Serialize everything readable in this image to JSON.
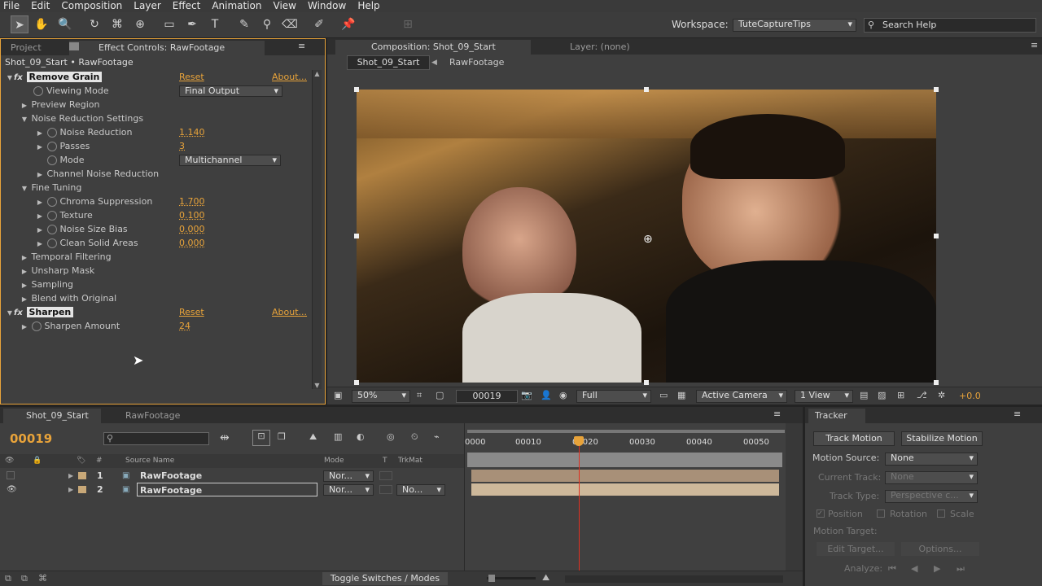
{
  "menu": [
    "File",
    "Edit",
    "Composition",
    "Layer",
    "Effect",
    "Animation",
    "View",
    "Window",
    "Help"
  ],
  "workspace": {
    "label": "Workspace:",
    "value": "TuteCaptureTips",
    "search_placeholder": "Search Help"
  },
  "left_panel": {
    "tabs": [
      "Project",
      "Effect Controls: RawFootage"
    ],
    "header": "Shot_09_Start • RawFootage",
    "effects": [
      {
        "name": "Remove Grain",
        "reset": "Reset",
        "about": "About..."
      },
      {
        "name": "Sharpen",
        "reset": "Reset",
        "about": "About..."
      }
    ],
    "rows": [
      {
        "label": "Viewing Mode",
        "value": "Final Output",
        "dropdown": true
      },
      {
        "label": "Preview Region"
      },
      {
        "label": "Noise Reduction Settings"
      },
      {
        "label": "Noise Reduction",
        "value": "1.140"
      },
      {
        "label": "Passes",
        "value": "3"
      },
      {
        "label": "Mode",
        "value": "Multichannel",
        "dropdown": true
      },
      {
        "label": "Channel Noise Reduction"
      },
      {
        "label": "Fine Tuning"
      },
      {
        "label": "Chroma Suppression",
        "value": "1.700"
      },
      {
        "label": "Texture",
        "value": "0.100"
      },
      {
        "label": "Noise Size Bias",
        "value": "0.000"
      },
      {
        "label": "Clean Solid Areas",
        "value": "0.000"
      },
      {
        "label": "Temporal Filtering"
      },
      {
        "label": "Unsharp Mask"
      },
      {
        "label": "Sampling"
      },
      {
        "label": "Blend with Original"
      },
      {
        "label": "Sharpen Amount",
        "value": "24"
      }
    ]
  },
  "comp_panel": {
    "tabs": [
      "Composition: Shot_09_Start",
      "Layer: (none)"
    ],
    "breadcrumb": [
      "Shot_09_Start",
      "RawFootage"
    ],
    "footer": {
      "zoom": "50%",
      "timecode": "00019",
      "resolution": "Full",
      "camera": "Active Camera",
      "view": "1 View",
      "exposure": "+0.0"
    }
  },
  "timeline": {
    "tabs": [
      "Shot_09_Start",
      "RawFootage"
    ],
    "current_time": "00019",
    "search_placeholder": "",
    "columns": [
      "#",
      "Source Name",
      "Mode",
      "T",
      "TrkMat"
    ],
    "layers": [
      {
        "num": "1",
        "name": "RawFootage",
        "mode": "Nor...",
        "trkmat": ""
      },
      {
        "num": "2",
        "name": "RawFootage",
        "mode": "Nor...",
        "trkmat": "No..."
      }
    ],
    "ruler": [
      "0000",
      "00010",
      "00020",
      "00030",
      "00040",
      "00050"
    ],
    "toggle_label": "Toggle Switches / Modes"
  },
  "tracker": {
    "title": "Tracker",
    "track_motion": "Track Motion",
    "stabilize_motion": "Stabilize Motion",
    "motion_source_label": "Motion Source:",
    "motion_source": "None",
    "current_track_label": "Current Track:",
    "current_track": "None",
    "track_type_label": "Track Type:",
    "track_type": "Perspective c...",
    "position": "Position",
    "rotation": "Rotation",
    "scale": "Scale",
    "motion_target": "Motion Target:",
    "edit_target": "Edit Target...",
    "options": "Options...",
    "analyze": "Analyze:"
  },
  "colors": {
    "accent": "#e8a33a",
    "panel": "#3f3f3f",
    "playhead": "#e03020"
  }
}
